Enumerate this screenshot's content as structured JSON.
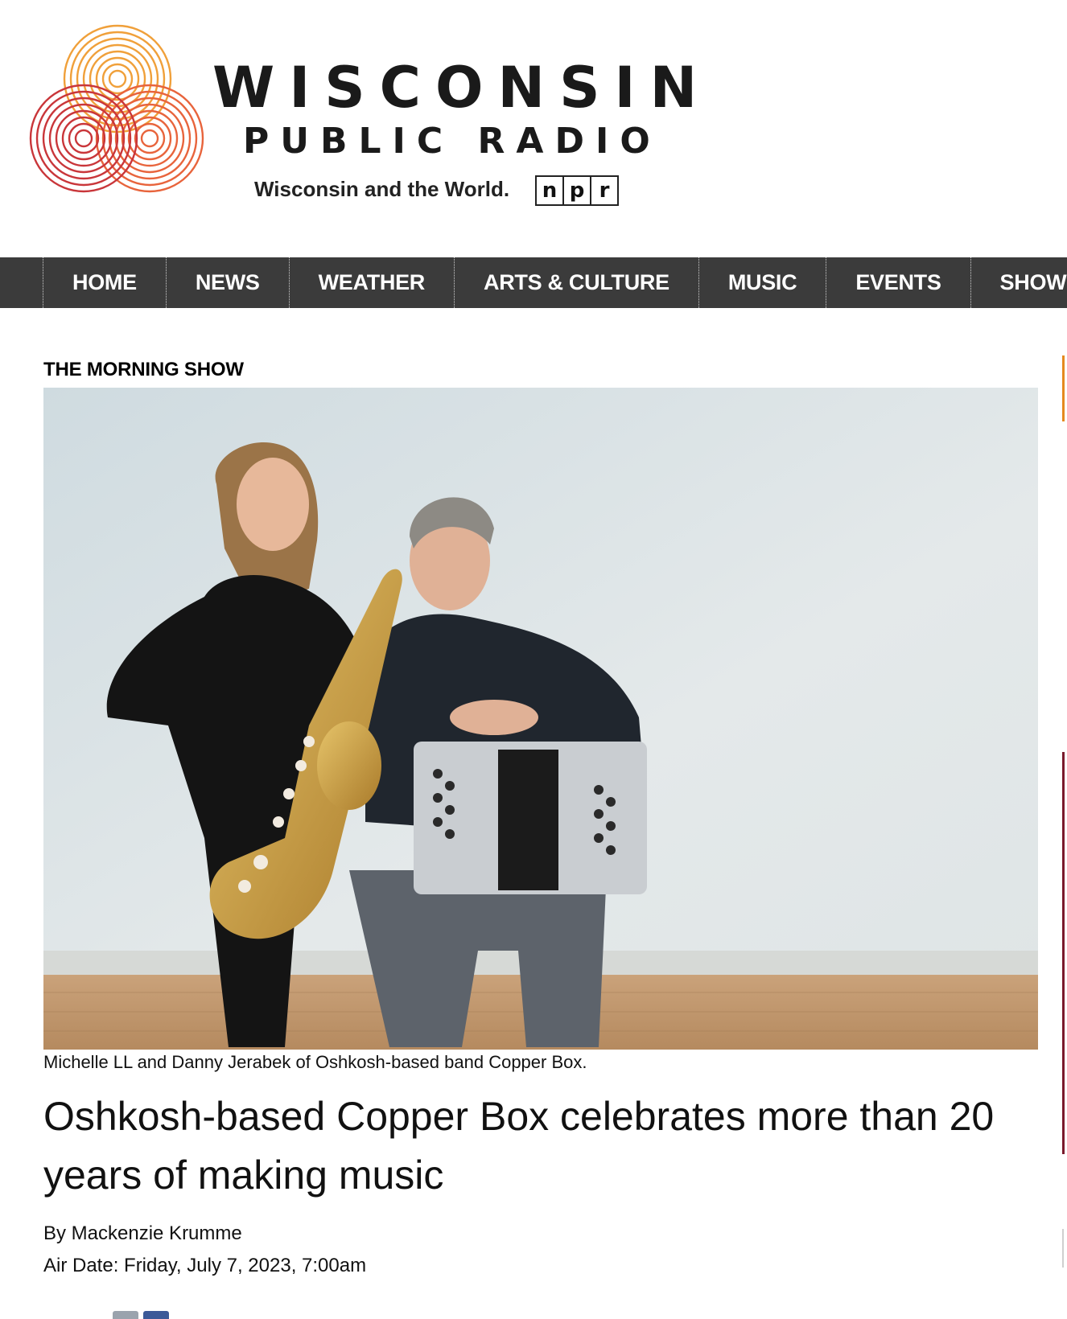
{
  "header": {
    "title": "WISCONSIN",
    "subtitle": "PUBLIC RADIO",
    "tagline": "Wisconsin and the World.",
    "npr_letters": [
      "n",
      "p",
      "r"
    ]
  },
  "nav": {
    "items": [
      {
        "label": "HOME"
      },
      {
        "label": "NEWS"
      },
      {
        "label": "WEATHER"
      },
      {
        "label": "ARTS & CULTURE"
      },
      {
        "label": "MUSIC"
      },
      {
        "label": "EVENTS"
      },
      {
        "label": "SHOWS"
      }
    ]
  },
  "article": {
    "kicker": "THE MORNING SHOW",
    "caption": "Michelle LL and Danny Jerabek of Oshkosh-based band Copper Box.",
    "headline": "Oshkosh-based Copper Box celebrates more than 20 years of making music",
    "byline": "By Mackenzie Krumme",
    "airdate": "Air Date: Friday, July 7, 2023, 7:00am"
  },
  "colors": {
    "nav_bg": "#3b3b3b",
    "logo_orange": "#f0a03a",
    "logo_red": "#c9363a",
    "logo_coral": "#e8643c"
  }
}
